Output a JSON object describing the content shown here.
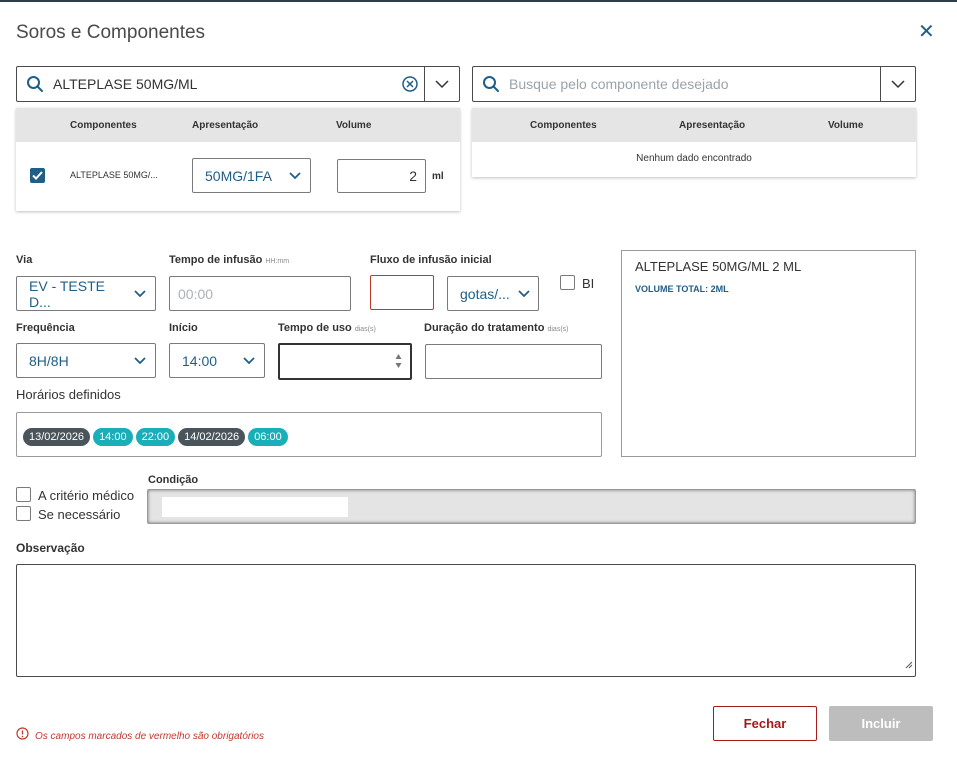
{
  "modal": {
    "title": "Soros e Componentes"
  },
  "left_search": {
    "value": "ALTEPLASE 50MG/ML"
  },
  "right_search": {
    "placeholder": "Busque pelo componente desejado"
  },
  "left_table": {
    "headers": [
      "Componentes",
      "Apresentação",
      "Volume"
    ],
    "row": {
      "component": "ALTEPLASE 50MG/...",
      "presentation": "50MG/1FA",
      "volume": "2",
      "unit": "ml"
    }
  },
  "right_table": {
    "headers": [
      "Componentes",
      "Apresentação",
      "Volume"
    ],
    "empty": "Nenhum dado encontrado"
  },
  "form": {
    "via": {
      "label": "Via",
      "value": "EV - TESTE D..."
    },
    "tempo_infusao": {
      "label": "Tempo de infusão",
      "hint": "HH:mm",
      "placeholder": "00:00"
    },
    "fluxo": {
      "label": "Fluxo de infusão inicial",
      "unit": "gotas/..."
    },
    "bi": {
      "label": "BI"
    },
    "frequencia": {
      "label": "Frequência",
      "value": "8H/8H"
    },
    "inicio": {
      "label": "Início",
      "value": "14:00"
    },
    "tempo_uso": {
      "label": "Tempo de uso",
      "hint": "dias(s)"
    },
    "duracao": {
      "label": "Duração do tratamento",
      "hint": "dias(s)"
    },
    "horarios": {
      "label": "Horários definidos",
      "chips": [
        {
          "text": "13/02/2026",
          "kind": "dark"
        },
        {
          "text": "14:00",
          "kind": "teal"
        },
        {
          "text": "22:00",
          "kind": "teal"
        },
        {
          "text": "14/02/2026",
          "kind": "dark"
        },
        {
          "text": "06:00",
          "kind": "teal"
        }
      ]
    },
    "criterio_medico": "A critério médico",
    "se_necessario": "Se necessário",
    "condicao": {
      "label": "Condição"
    },
    "observacao": {
      "label": "Observação"
    }
  },
  "summary": {
    "line1": "ALTEPLASE 50MG/ML 2 ML",
    "line2": "VOLUME TOTAL: 2ML"
  },
  "footer": {
    "required_note": "Os campos marcados de vermelho são obrigatórios",
    "close_label": "Fechar",
    "include_label": "Incluir"
  },
  "colors": {
    "accent": "#1f5e86",
    "teal": "#1aafb8",
    "error": "#c0392b",
    "disabled": "#bdbdbd"
  }
}
